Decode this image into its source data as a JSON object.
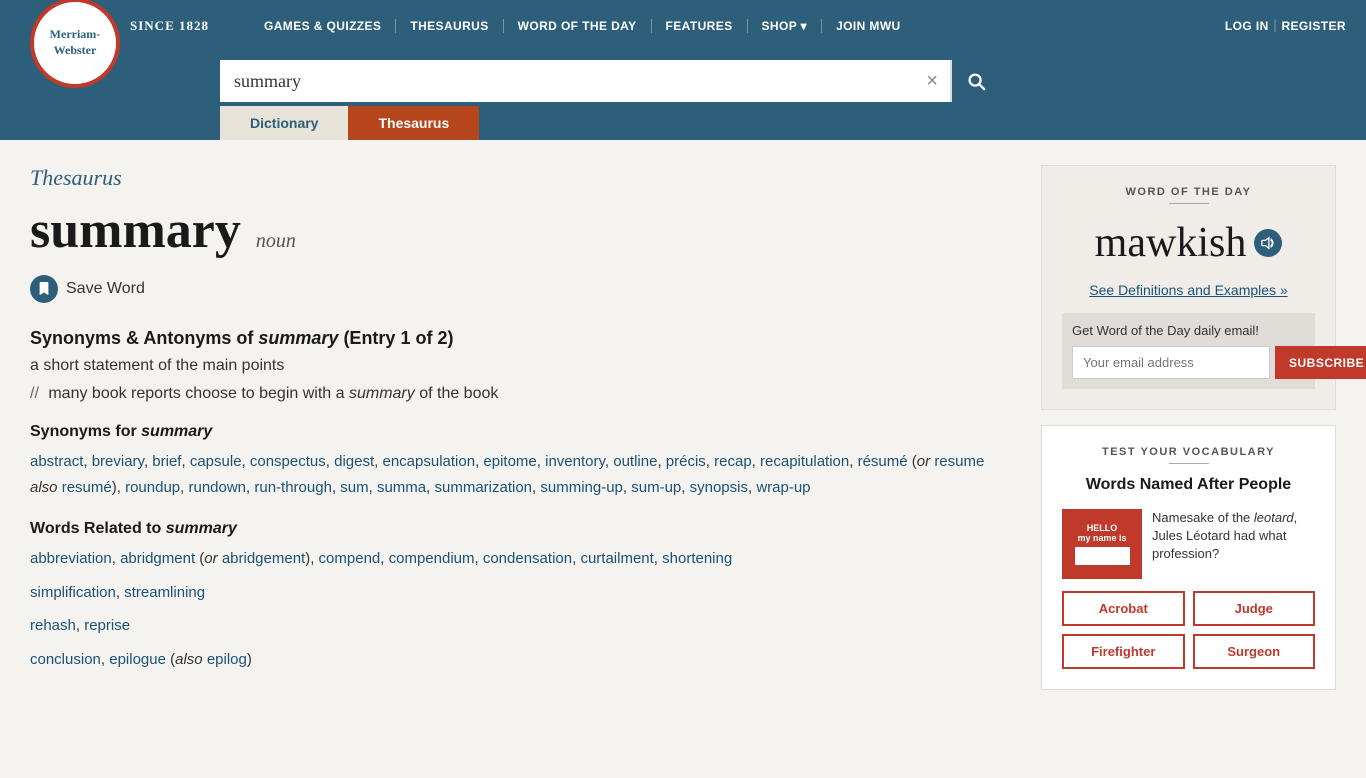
{
  "header": {
    "logo_line1": "Merriam-",
    "logo_line2": "Webster",
    "since": "SINCE 1828",
    "nav": [
      {
        "label": "GAMES & QUIZZES",
        "id": "games"
      },
      {
        "label": "THESAURUS",
        "id": "thesaurus"
      },
      {
        "label": "WORD OF THE DAY",
        "id": "wotd"
      },
      {
        "label": "FEATURES",
        "id": "features"
      },
      {
        "label": "SHOP ▾",
        "id": "shop"
      },
      {
        "label": "JOIN MWU",
        "id": "join"
      }
    ],
    "auth": {
      "login": "LOG IN",
      "register": "REGISTER"
    }
  },
  "search": {
    "value": "summary",
    "placeholder": "summary",
    "clear_label": "×"
  },
  "tabs": {
    "dictionary": "Dictionary",
    "thesaurus": "Thesaurus"
  },
  "main": {
    "section_label": "Thesaurus",
    "word": "summary",
    "pos": "noun",
    "save_word": "Save Word",
    "entry_heading": "Synonyms & Antonyms of",
    "entry_word": "summary",
    "entry_sub": "(Entry 1 of 2)",
    "definition": "a short statement of the main points",
    "example_prefix": "//",
    "example": "many book reports choose to begin with a",
    "example_word": "summary",
    "example_suffix": "of the book",
    "synonyms_label": "Synonyms for",
    "synonyms_word": "summary",
    "synonyms": [
      "abstract",
      "breviary",
      "brief",
      "capsule",
      "conspectus",
      "digest",
      "encapsulation",
      "epitome",
      "inventory",
      "outline",
      "précis",
      "recap",
      "recapitulation",
      "résumé",
      "resume",
      "resumé",
      "roundup",
      "rundown",
      "run-through",
      "sum",
      "summa",
      "summarization",
      "summing-up",
      "sum-up",
      "synopsis",
      "wrap-up"
    ],
    "synonyms_extra": "(or resume also resumé),",
    "related_label": "Words Related to",
    "related_word": "summary",
    "related_group1": [
      "abbreviation",
      "abridgment",
      "abridgement",
      "compend",
      "compendium",
      "condensation",
      "curtailment",
      "shortening"
    ],
    "related_group1_note": "(or abridgement),",
    "related_group2": [
      "simplification",
      "streamlining"
    ],
    "related_group3": [
      "rehash",
      "reprise"
    ],
    "related_group4": [
      "conclusion",
      "epilogue",
      "epilog"
    ],
    "related_group4_note": "(also epilog)"
  },
  "sidebar": {
    "wotd": {
      "section_label": "WORD OF THE DAY",
      "word": "mawkish",
      "link_text": "See Definitions and Examples",
      "link_suffix": "»",
      "email_prompt": "Get Word of the Day daily email!",
      "email_placeholder": "Your email address",
      "subscribe_label": "SUBSCRIBE"
    },
    "vocab": {
      "section_label": "TEST YOUR VOCABULARY",
      "title": "Words Named After People",
      "image_label": "HELLO\nmy name is",
      "description": "Namesake of the leotard, Jules Léotard had what profession?",
      "description_em": "leotard",
      "buttons": [
        "Acrobat",
        "Judge",
        "Firefighter",
        "Surgeon"
      ]
    }
  }
}
